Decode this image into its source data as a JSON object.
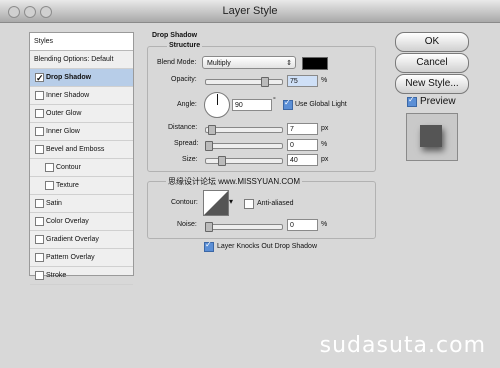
{
  "window": {
    "title": "Layer Style"
  },
  "sidebar": {
    "header": "Styles",
    "items": [
      {
        "label": "Blending Options: Default",
        "checked": null,
        "sub": false,
        "active": false
      },
      {
        "label": "Drop Shadow",
        "checked": true,
        "sub": false,
        "active": true
      },
      {
        "label": "Inner Shadow",
        "checked": false,
        "sub": false,
        "active": false
      },
      {
        "label": "Outer Glow",
        "checked": false,
        "sub": false,
        "active": false
      },
      {
        "label": "Inner Glow",
        "checked": false,
        "sub": false,
        "active": false
      },
      {
        "label": "Bevel and Emboss",
        "checked": false,
        "sub": false,
        "active": false
      },
      {
        "label": "Contour",
        "checked": false,
        "sub": true,
        "active": false
      },
      {
        "label": "Texture",
        "checked": false,
        "sub": true,
        "active": false
      },
      {
        "label": "Satin",
        "checked": false,
        "sub": false,
        "active": false
      },
      {
        "label": "Color Overlay",
        "checked": false,
        "sub": false,
        "active": false
      },
      {
        "label": "Gradient Overlay",
        "checked": false,
        "sub": false,
        "active": false
      },
      {
        "label": "Pattern Overlay",
        "checked": false,
        "sub": false,
        "active": false
      },
      {
        "label": "Stroke",
        "checked": false,
        "sub": false,
        "active": false
      }
    ]
  },
  "drop_shadow": {
    "title": "Drop Shadow",
    "structure": {
      "title": "Structure",
      "blend_mode_label": "Blend Mode:",
      "blend_mode_value": "Multiply",
      "shadow_color": "#000000",
      "opacity_label": "Opacity:",
      "opacity_value": "75",
      "opacity_level": 0.75,
      "opacity_unit": "%",
      "angle_label": "Angle:",
      "angle_value": "90",
      "angle_unit": "°",
      "use_global_light_label": "Use Global Light",
      "use_global_light": true,
      "distance_label": "Distance:",
      "distance_value": "7",
      "distance_level": 0.05,
      "distance_unit": "px",
      "spread_label": "Spread:",
      "spread_value": "0",
      "spread_level": 0,
      "spread_unit": "%",
      "size_label": "Size:",
      "size_value": "40",
      "size_level": 0.16,
      "size_unit": "px"
    },
    "quality": {
      "title": "思缘设计论坛 www.MISSYUAN.COM",
      "contour_label": "Contour:",
      "anti_aliased_label": "Anti-aliased",
      "anti_aliased": false,
      "noise_label": "Noise:",
      "noise_value": "0",
      "noise_level": 0,
      "noise_unit": "%"
    },
    "knockout_label": "Layer Knocks Out Drop Shadow",
    "knockout": true
  },
  "buttons": {
    "ok": "OK",
    "cancel": "Cancel",
    "new_style": "New Style..."
  },
  "preview": {
    "label": "Preview",
    "checked": true
  },
  "watermark": "sudasuta.com"
}
